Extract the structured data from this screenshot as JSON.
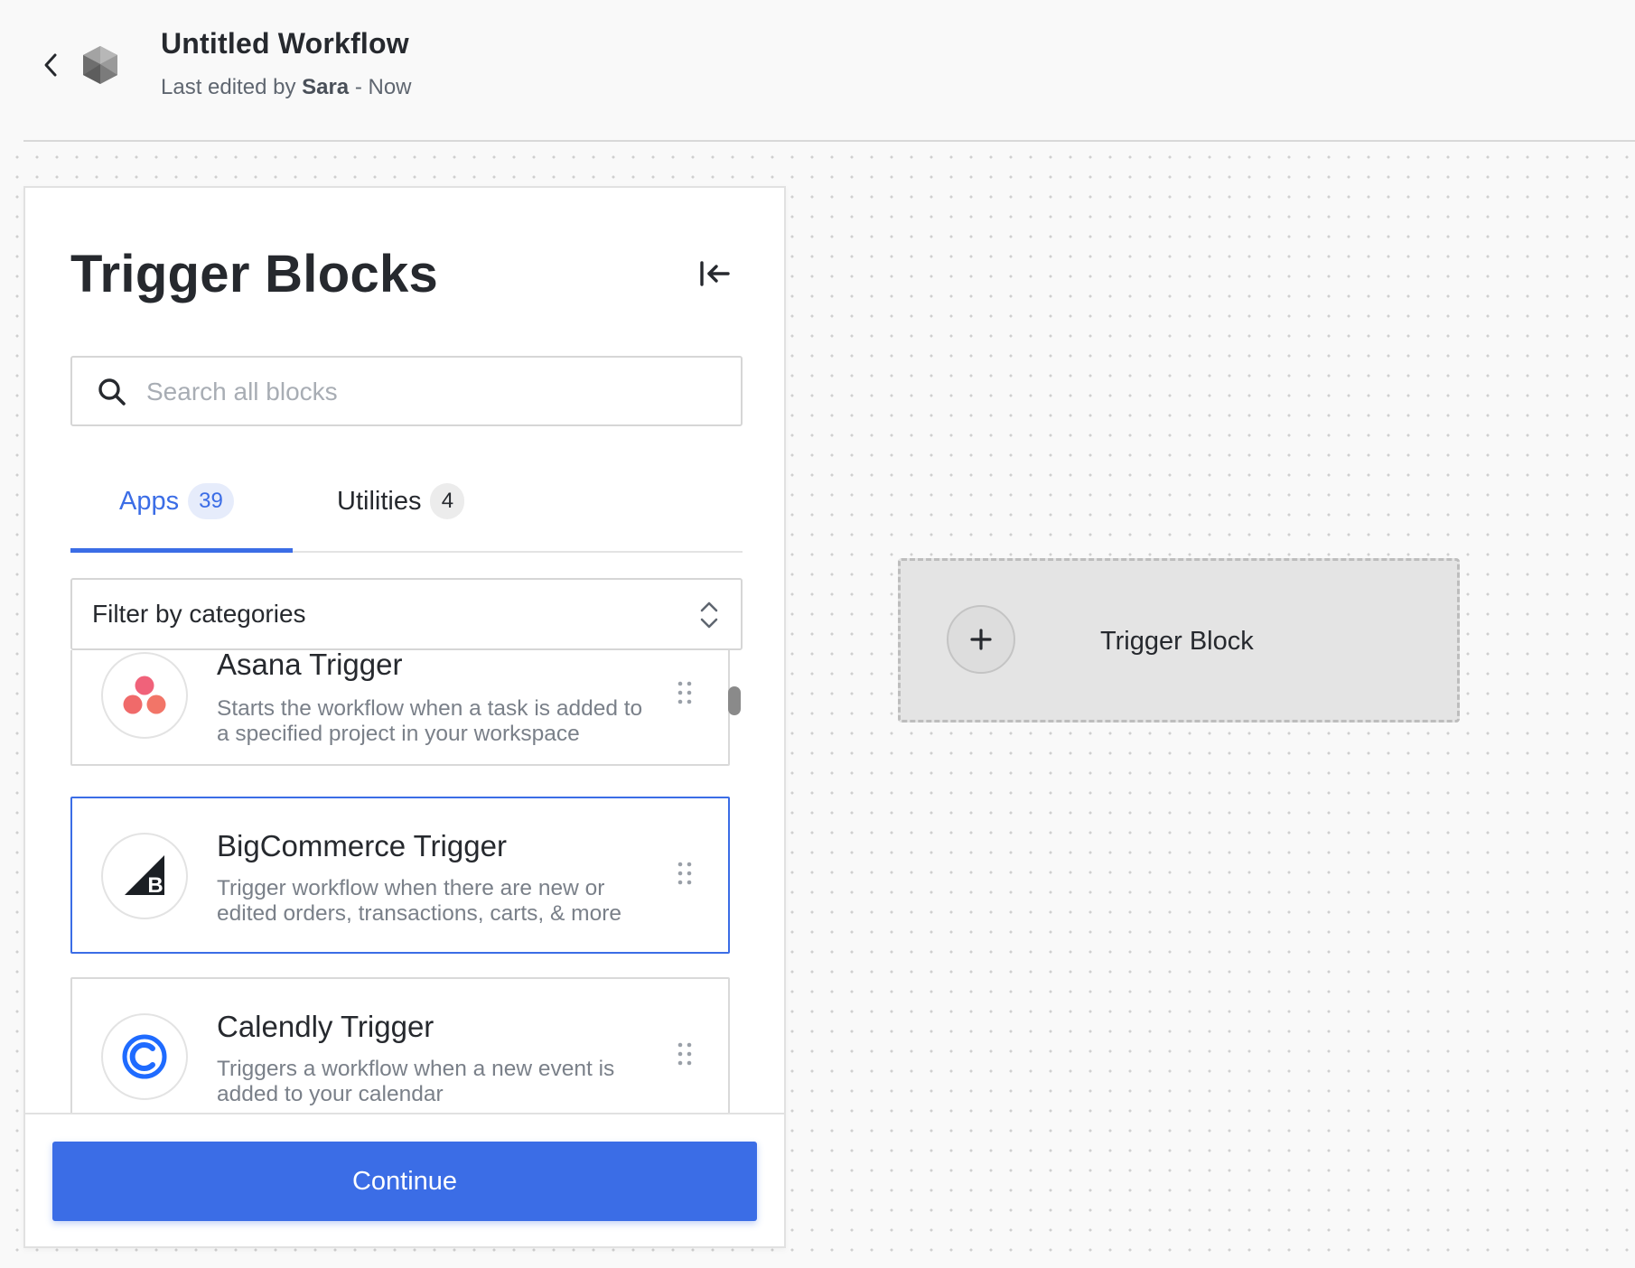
{
  "header": {
    "title": "Untitled Workflow",
    "edited_prefix": "Last edited by",
    "editor": "Sara",
    "edited_suffix": "- Now"
  },
  "panel": {
    "title": "Trigger Blocks",
    "search": {
      "placeholder": "Search all blocks",
      "value": ""
    },
    "tabs": [
      {
        "label": "Apps",
        "count": "39",
        "active": true
      },
      {
        "label": "Utilities",
        "count": "4",
        "active": false
      }
    ],
    "filter": {
      "label": "Filter by categories"
    },
    "items": [
      {
        "title": "Asana Trigger",
        "description": "Starts the workflow when a task is added to a specified project in your workspace",
        "icon": "asana-icon",
        "selected": false
      },
      {
        "title": "BigCommerce Trigger",
        "description": "Trigger workflow when there are new or edited orders, transactions, carts, & more",
        "icon": "bigcommerce-icon",
        "selected": true
      },
      {
        "title": "Calendly Trigger",
        "description": "Triggers a workflow when a new event is added to your calendar",
        "icon": "calendly-icon",
        "selected": false
      }
    ],
    "continue_label": "Continue"
  },
  "canvas": {
    "placeholder_label": "Trigger Block",
    "add_icon": "plus-icon"
  },
  "colors": {
    "accent": "#3b6de6",
    "accent_light": "#e6ecfb",
    "text": "#26292e",
    "muted_text": "#7a8089"
  }
}
